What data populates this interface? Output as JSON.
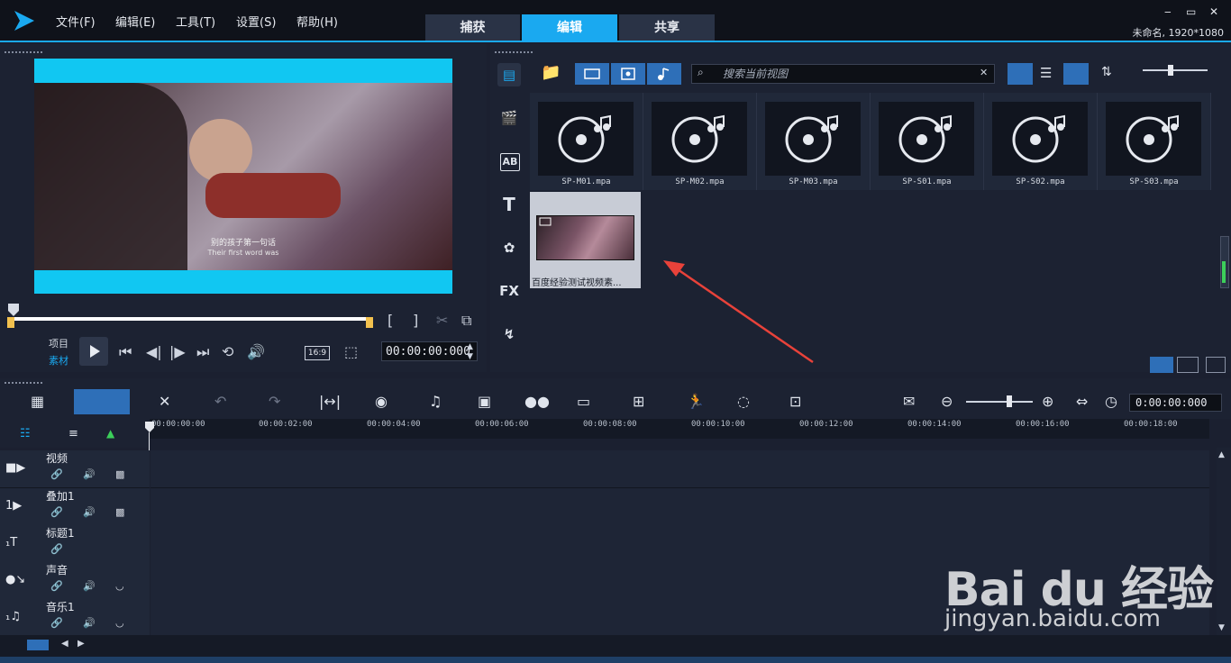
{
  "menu": {
    "items": [
      "文件(F)",
      "编辑(E)",
      "工具(T)",
      "设置(S)",
      "帮助(H)"
    ]
  },
  "tabs": [
    {
      "label": "捕获",
      "active": false
    },
    {
      "label": "编辑",
      "active": true
    },
    {
      "label": "共享",
      "active": false
    }
  ],
  "project": {
    "info": "未命名, 1920*1080"
  },
  "window_controls": {
    "minimize": "‒",
    "restore": "▭",
    "close": "✕"
  },
  "player": {
    "subtitle_cn": "别的孩子第一句话",
    "subtitle_en": "Their first word was",
    "mode_project": "项目",
    "mode_clip": "素材",
    "aspect": "16:9",
    "timecode": "00:00:00:000"
  },
  "library": {
    "search_placeholder": "搜索当前视图",
    "items": [
      {
        "label": "SP-M01.mpa"
      },
      {
        "label": "SP-M02.mpa"
      },
      {
        "label": "SP-M03.mpa"
      },
      {
        "label": "SP-S01.mpa"
      },
      {
        "label": "SP-S02.mpa"
      },
      {
        "label": "SP-S03.mpa"
      }
    ],
    "media_item": {
      "label": "百度经验测试视频素..."
    },
    "side_fx_label": "FX",
    "side_text_label": "T",
    "side_ab_label": "AB"
  },
  "timeline": {
    "timecode": "0:00:00:000",
    "ruler": [
      "00:00:00:00",
      "00:00:02:00",
      "00:00:04:00",
      "00:00:06:00",
      "00:00:08:00",
      "00:00:10:00",
      "00:00:12:00",
      "00:00:14:00",
      "00:00:16:00",
      "00:00:18:00"
    ],
    "tracks": [
      {
        "name": "视频"
      },
      {
        "name": "叠加1"
      },
      {
        "name": "标题1"
      },
      {
        "name": "声音"
      },
      {
        "name": "音乐1"
      }
    ]
  },
  "watermark": {
    "brand": "Bai du 经验",
    "url": "jingyan.baidu.com"
  },
  "colors": {
    "accent": "#1aa9f0",
    "preview_bg": "#11c7f2",
    "arrow": "#e8423a"
  }
}
